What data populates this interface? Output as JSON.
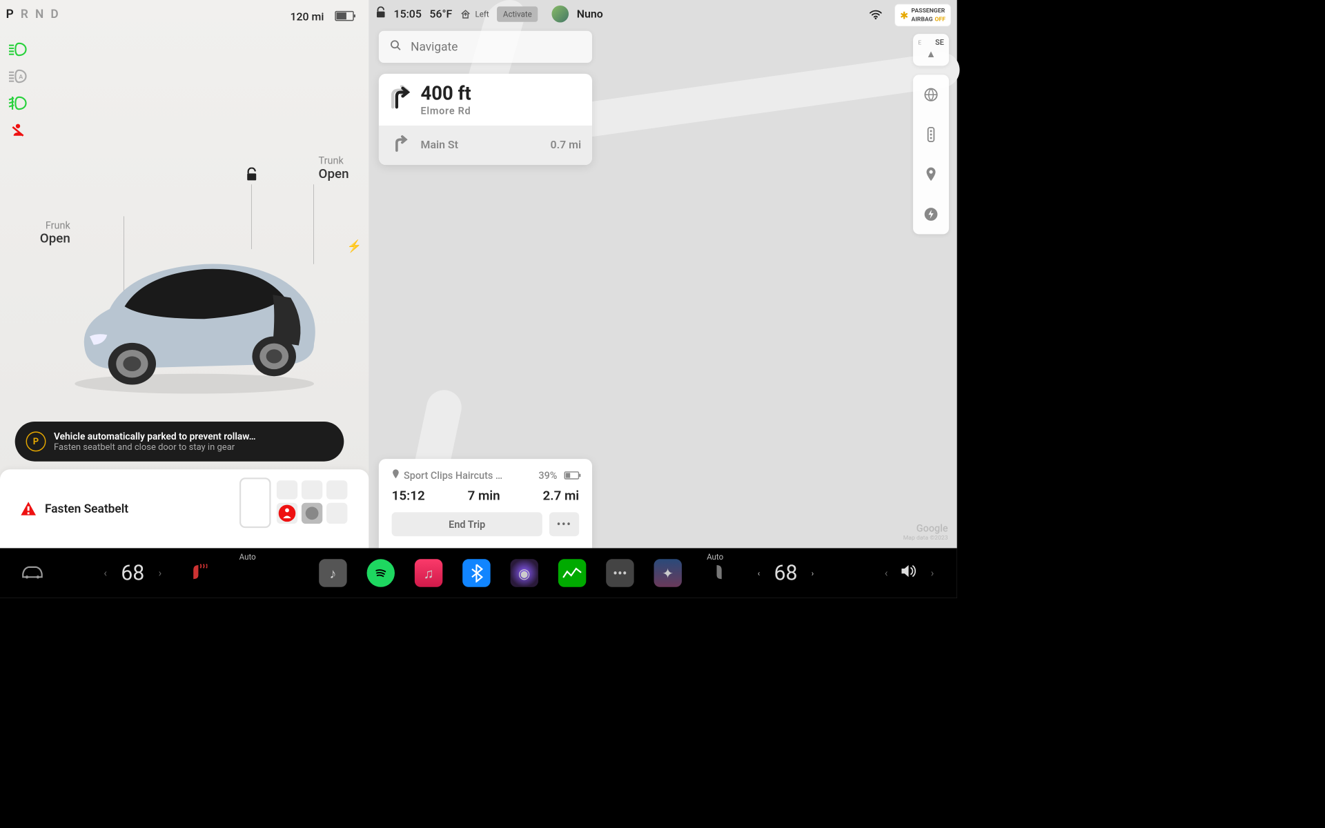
{
  "statusbar": {
    "gear_letters": [
      "P",
      "R",
      "N",
      "D"
    ],
    "gear_active": "P",
    "range": "120 mi"
  },
  "indicators": {
    "headlight": "on",
    "auto_headlight": "auto",
    "foglight": "on",
    "seatbelt": "warning"
  },
  "car_status": {
    "frunk_label": "Frunk",
    "frunk_state": "Open",
    "trunk_label": "Trunk",
    "trunk_state": "Open",
    "lock": "unlocked"
  },
  "alert": {
    "line1": "Vehicle automatically parked to prevent rollaw…",
    "line2": "Fasten seatbelt and close door to stay in gear"
  },
  "seatbelt_card": {
    "title": "Fasten Seatbelt"
  },
  "right_top": {
    "time": "15:05",
    "temp": "56°F",
    "homelink_hint": "Left",
    "activate": "Activate",
    "user": "Nuno",
    "airbag_line1": "PASSENGER",
    "airbag_line2": "AIRBAG",
    "airbag_off": "OFF"
  },
  "search": {
    "placeholder": "Navigate"
  },
  "nav": {
    "current": {
      "distance": "400 ft",
      "road": "Elmore Rd"
    },
    "next": {
      "road": "Main St",
      "distance": "0.7 mi"
    }
  },
  "compass": {
    "sub": "E",
    "main": "SE"
  },
  "trip": {
    "destination": "Sport Clips Haircuts …",
    "soc": "39%",
    "eta": "15:12",
    "duration": "7 min",
    "remaining": "2.7 mi",
    "end_trip": "End Trip"
  },
  "map_attrib": {
    "brand": "Google",
    "data": "Map data ©2023"
  },
  "dock": {
    "auto_label": "Auto",
    "temp_left": "68",
    "temp_right": "68"
  }
}
